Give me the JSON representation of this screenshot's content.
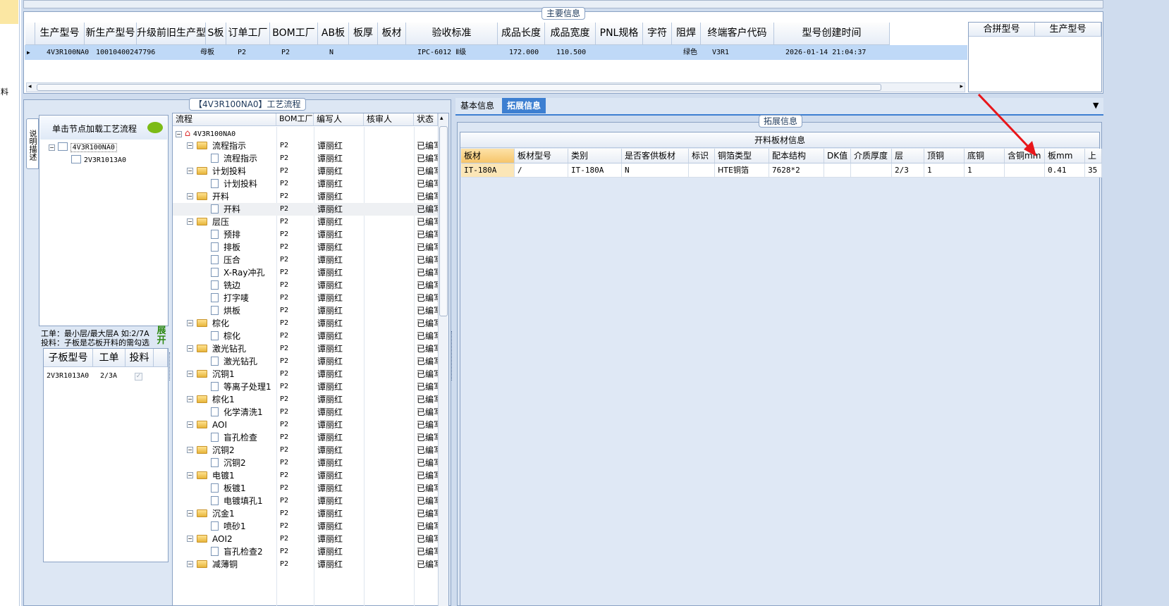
{
  "leftnav": {
    "char": "料"
  },
  "main_info": {
    "title": "主要信息",
    "columns": [
      "生产型号",
      "新生产型号",
      "升级前旧生产型号",
      "S板",
      "订单工厂",
      "BOM工厂",
      "AB板",
      "板厚",
      "板材",
      "验收标准",
      "成品长度",
      "成品宽度",
      "PNL规格",
      "字符",
      "阻焊",
      "终端客户代码",
      "型号创建时间"
    ],
    "row": [
      "4V3R100NA0",
      "10010400247796",
      "",
      "母板",
      "P2",
      "P2",
      "N",
      "",
      "",
      "IPC-6012 Ⅱ级",
      "172.000",
      "110.500",
      "",
      "",
      "绿色",
      "V3R1",
      "2026-01-14 21:04:37"
    ],
    "right_columns": [
      "合拼型号",
      "生产型号"
    ]
  },
  "process": {
    "title": "【4V3R100NA0】工艺流程",
    "side_tab": "说明描述",
    "node_hint": "单击节点加载工艺流程",
    "nodes": [
      "4V3R100NA0",
      "2V3R1013A0"
    ],
    "info_line1": "工单：最小层/最大层A 如:2/7A",
    "info_line2": "投料：子板是芯板开料的需勾选",
    "expand_label": "展开",
    "sub_columns": [
      "子板型号",
      "工单",
      "投料"
    ],
    "sub_row": [
      "2V3R1013A0",
      "2/3A"
    ],
    "flow_columns": [
      "流程",
      "BOM工厂",
      "编写人",
      "核审人",
      "状态"
    ],
    "flow_root": "4V3R100NA0",
    "flow_rows": [
      {
        "name": "流程指示",
        "level": 1
      },
      {
        "name": "流程指示",
        "level": 2
      },
      {
        "name": "计划投料",
        "level": 1
      },
      {
        "name": "计划投料",
        "level": 2
      },
      {
        "name": "开料",
        "level": 1
      },
      {
        "name": "开料",
        "level": 2
      },
      {
        "name": "层压",
        "level": 1
      },
      {
        "name": "预排",
        "level": 2
      },
      {
        "name": "排板",
        "level": 2
      },
      {
        "name": "压合",
        "level": 2
      },
      {
        "name": "X-Ray冲孔",
        "level": 2
      },
      {
        "name": "铣边",
        "level": 2
      },
      {
        "name": "打字唛",
        "level": 2
      },
      {
        "name": "烘板",
        "level": 2
      },
      {
        "name": "棕化",
        "level": 1
      },
      {
        "name": "棕化",
        "level": 2
      },
      {
        "name": "激光钻孔",
        "level": 1
      },
      {
        "name": "激光钻孔",
        "level": 2
      },
      {
        "name": "沉铜1",
        "level": 1
      },
      {
        "name": "等离子处理1",
        "level": 2
      },
      {
        "name": "棕化1",
        "level": 1
      },
      {
        "name": "化学清洗1",
        "level": 2
      },
      {
        "name": "AOI",
        "level": 1
      },
      {
        "name": "盲孔检查",
        "level": 2
      },
      {
        "name": "沉铜2",
        "level": 1
      },
      {
        "name": "沉铜2",
        "level": 2
      },
      {
        "name": "电镀1",
        "level": 1
      },
      {
        "name": "板镀1",
        "level": 2
      },
      {
        "name": "电镀填孔1",
        "level": 2
      },
      {
        "name": "沉金1",
        "level": 1
      },
      {
        "name": "喷砂1",
        "level": 2
      },
      {
        "name": "AOI2",
        "level": 1
      },
      {
        "name": "盲孔检查2",
        "level": 2
      },
      {
        "name": "减薄铜",
        "level": 1
      }
    ],
    "flow_bom": "P2",
    "flow_writer": "谭丽红",
    "flow_status": "已编写"
  },
  "tabs": {
    "basic": "基本信息",
    "ext": "拓展信息"
  },
  "ext": {
    "title": "拓展信息",
    "table_title": "开料板材信息",
    "columns": [
      "板材",
      "板材型号",
      "类别",
      "是否客供板材",
      "标识",
      "铜箔类型",
      "配本结构",
      "DK值",
      "介质厚度",
      "层",
      "顶铜",
      "底铜",
      "含铜mm",
      "板mm",
      "上"
    ],
    "row": [
      "IT-180A",
      "/",
      "IT-180A",
      "N",
      "",
      "HTE铜箔",
      "7628*2",
      "",
      "",
      "2/3",
      "1",
      "1",
      "",
      "0.41",
      "35"
    ]
  }
}
